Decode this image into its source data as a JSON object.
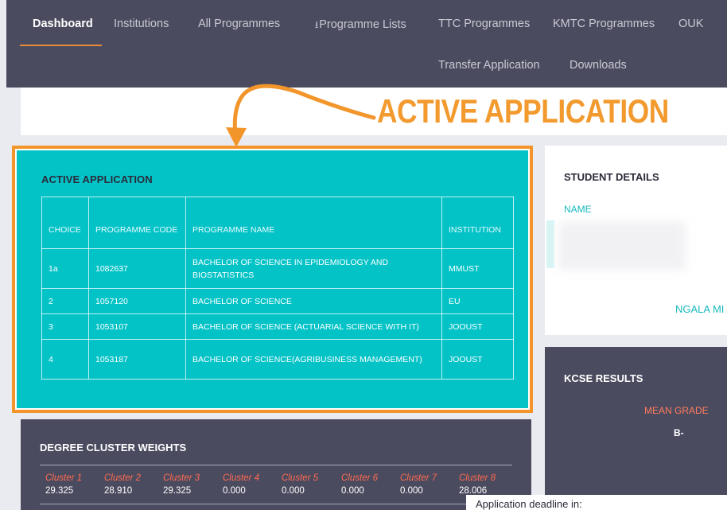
{
  "nav": {
    "items": [
      {
        "label": "Dashboard",
        "active": true
      },
      {
        "label": "Institutions"
      },
      {
        "label": "All Programmes"
      },
      {
        "label": "Programme Lists",
        "icon": "download-icon"
      },
      {
        "label": "TTC Programmes"
      },
      {
        "label": "KMTC Programmes"
      },
      {
        "label": "OUK"
      },
      {
        "label": "Transfer Application"
      },
      {
        "label": "Downloads"
      }
    ]
  },
  "annotation": {
    "text": "ACTIVE APPLICATION",
    "color": "#f2952a"
  },
  "active_application": {
    "title": "ACTIVE APPLICATION",
    "headers": [
      "CHOICE",
      "PROGRAMME CODE",
      "PROGRAMME NAME",
      "INSTITUTION"
    ],
    "rows": [
      {
        "choice": "1a",
        "code": "1082637",
        "name": "BACHELOR OF SCIENCE IN EPIDEMIOLOGY AND BIOSTATISTICS",
        "institution": "MMUST"
      },
      {
        "choice": "2",
        "code": "1057120",
        "name": "BACHELOR OF SCIENCE",
        "institution": "EU"
      },
      {
        "choice": "3",
        "code": "1053107",
        "name": "BACHELOR OF SCIENCE (ACTUARIAL SCIENCE WITH IT)",
        "institution": "JOOUST"
      },
      {
        "choice": "4",
        "code": "1053187",
        "name": "BACHELOR OF SCIENCE(AGRIBUSINESS MANAGEMENT)",
        "institution": "JOOUST"
      }
    ],
    "accent": "#03c3c7"
  },
  "student_details": {
    "title": "STUDENT DETAILS",
    "name_label": "NAME",
    "name_value": "NGALA MI"
  },
  "kcse_results": {
    "title": "KCSE RESULTS",
    "mean_grade_label": "MEAN GRADE",
    "mean_grade_value": "B-"
  },
  "cluster_weights": {
    "title": "DEGREE CLUSTER WEIGHTS",
    "clusters": [
      {
        "label": "Cluster 1",
        "value": "29.325"
      },
      {
        "label": "Cluster 2",
        "value": "28.910"
      },
      {
        "label": "Cluster 3",
        "value": "29.325"
      },
      {
        "label": "Cluster 4",
        "value": "0.000"
      },
      {
        "label": "Cluster 5",
        "value": "0.000"
      },
      {
        "label": "Cluster 6",
        "value": "0.000"
      },
      {
        "label": "Cluster 7",
        "value": "0.000"
      },
      {
        "label": "Cluster 8",
        "value": "28.006"
      }
    ]
  },
  "deadline": {
    "text": "Application deadline in:"
  }
}
